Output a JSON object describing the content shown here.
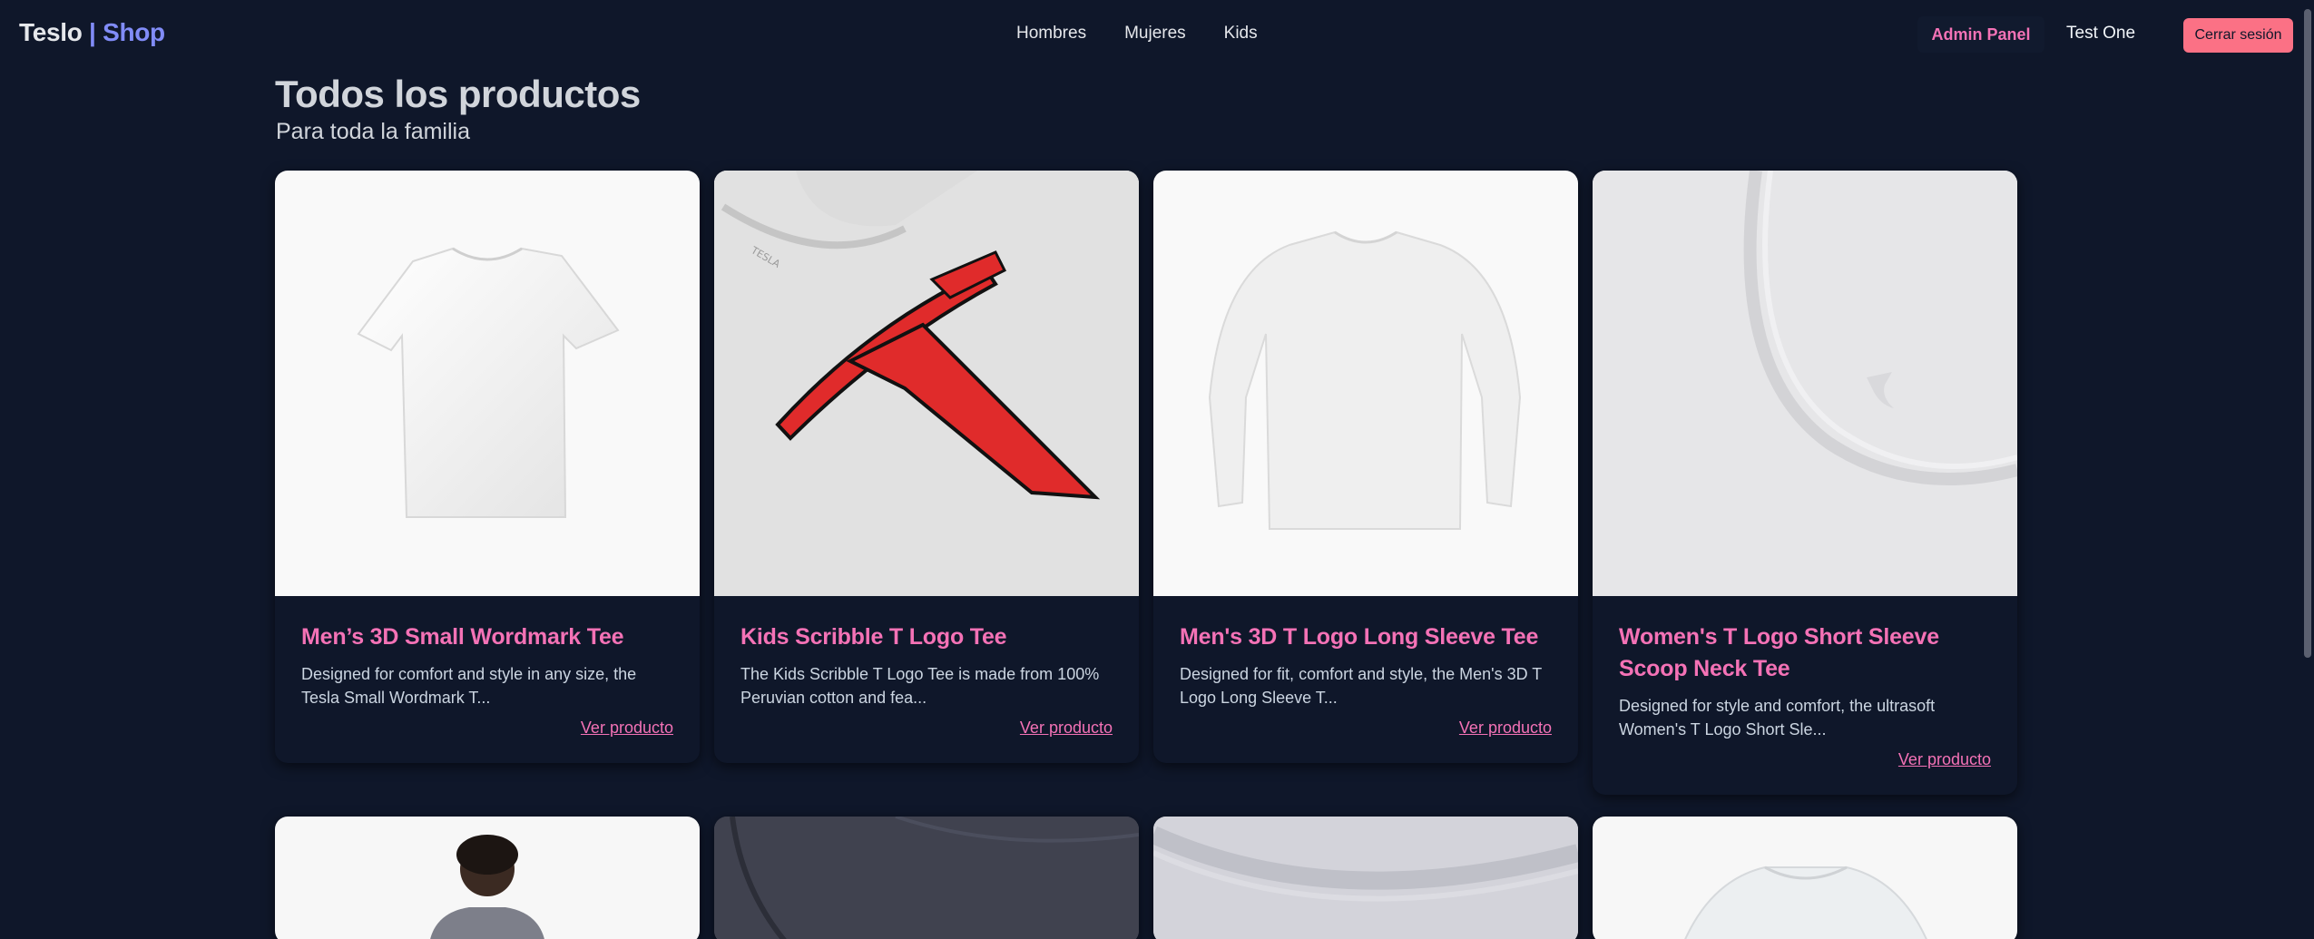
{
  "header": {
    "brand_name": "Teslo",
    "brand_sep": "|",
    "brand_suffix": "Shop",
    "nav": [
      "Hombres",
      "Mujeres",
      "Kids"
    ],
    "admin_label": "Admin Panel",
    "user_label": "Test One",
    "logout_label": "Cerrar sesión"
  },
  "main": {
    "title": "Todos los productos",
    "subtitle": "Para toda la familia",
    "link_label": "Ver producto",
    "products": [
      {
        "title": "Men’s 3D Small Wordmark Tee",
        "description": "Designed for comfort and style in any size, the Tesla Small Wordmark T..."
      },
      {
        "title": "Kids Scribble T Logo Tee",
        "description": "The Kids Scribble T Logo Tee is made from 100% Peruvian cotton and fea..."
      },
      {
        "title": "Men's 3D T Logo Long Sleeve Tee",
        "description": "Designed for fit, comfort and style, the Men's 3D T Logo Long Sleeve T..."
      },
      {
        "title": "Women's T Logo Short Sleeve Scoop Neck Tee",
        "description": "Designed for style and comfort, the ultrasoft Women's T Logo Short Sle..."
      }
    ]
  },
  "colors": {
    "background": "#0f172a",
    "accent": "#f472b6",
    "brand_accent": "#818cf8",
    "logout_bg": "#fb7185"
  }
}
